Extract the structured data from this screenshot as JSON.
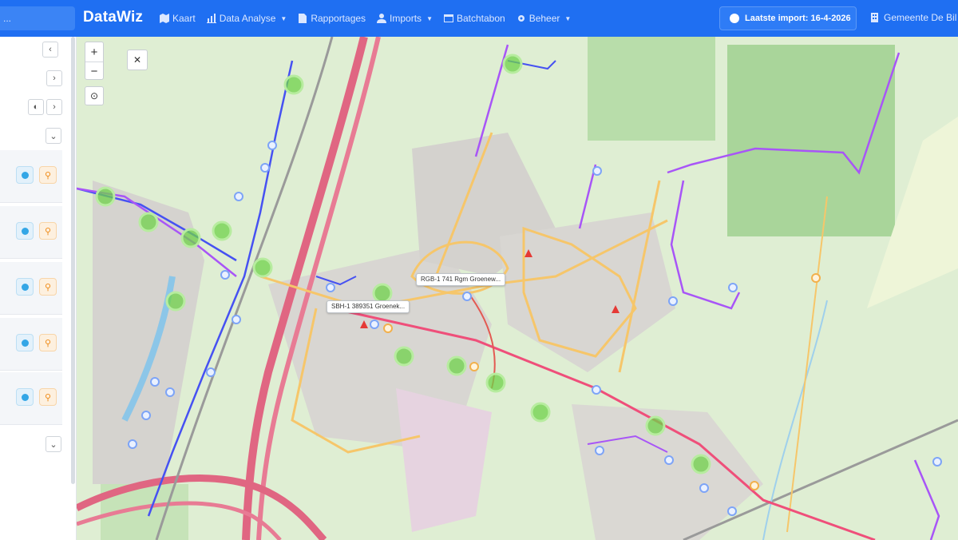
{
  "navbar": {
    "search_stub": "...",
    "brand": "DataWiz",
    "menu": [
      {
        "label": "Kaart",
        "icon": "map-icon",
        "dropdown": false
      },
      {
        "label": "Data Analyse",
        "icon": "chart-icon",
        "dropdown": true
      },
      {
        "label": "Rapportages",
        "icon": "report-icon",
        "dropdown": false
      },
      {
        "label": "Imports",
        "icon": "upload-icon",
        "dropdown": true
      },
      {
        "label": "Batchtabon",
        "icon": "batch-icon",
        "dropdown": false
      },
      {
        "label": "Beheer",
        "icon": "gear-icon",
        "dropdown": true
      }
    ],
    "import_button": "Laatste import: 16-4-2026",
    "municipality": "Gemeente De Bil"
  },
  "sidebar": {
    "collapse_icon": "chevron-left-icon",
    "rows": 5
  },
  "map": {
    "popup_1": "RGB-1 741 Rgm Groenew...",
    "popup_2": "SBH-1 389351 Groenek...",
    "colors": {
      "water_pipe": "#4651f2",
      "sewer_pipe": "#a855f7",
      "road_main": "#e45b7a",
      "road_local": "#f6c66a",
      "green_marker": "#6fd14a",
      "node_marker": "#7da4f7"
    }
  }
}
